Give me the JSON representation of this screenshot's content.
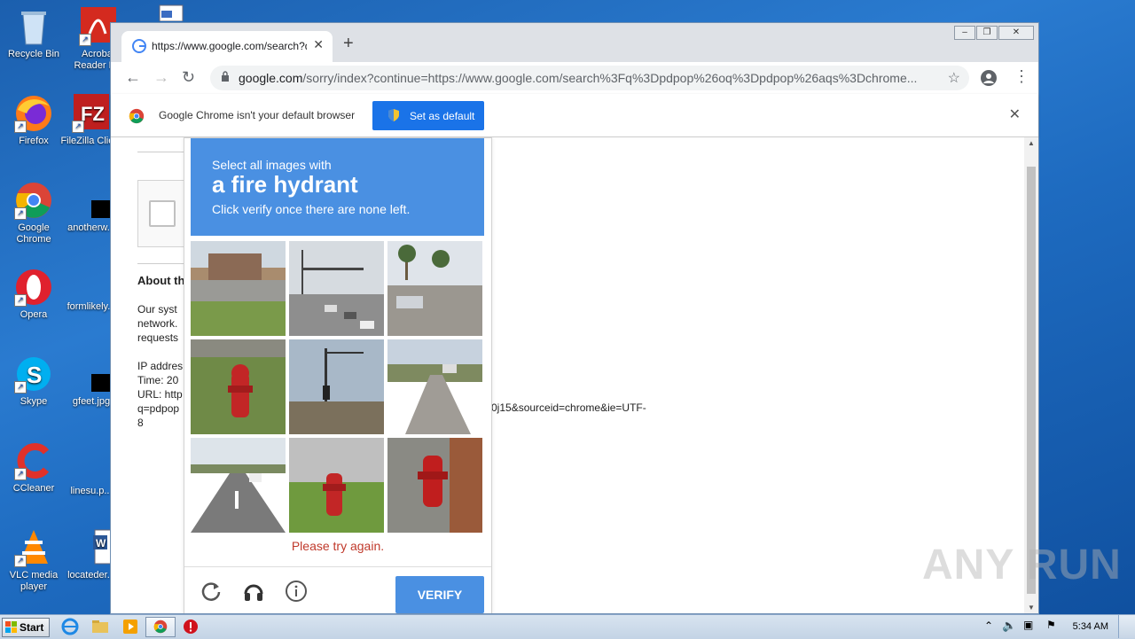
{
  "desktop": {
    "icons": [
      {
        "label": "Recycle Bin"
      },
      {
        "label": "Acrobat Reader DC"
      },
      {
        "label": "Firefox"
      },
      {
        "label": "FileZilla Client"
      },
      {
        "label": "Google Chrome"
      },
      {
        "label": "anotherw..."
      },
      {
        "label": "Opera"
      },
      {
        "label": "formlikely..."
      },
      {
        "label": "Skype"
      },
      {
        "label": "gfeet.jpg"
      },
      {
        "label": "CCleaner"
      },
      {
        "label": "linesu.p..."
      },
      {
        "label": "VLC media player"
      },
      {
        "label": "locateder..."
      }
    ]
  },
  "browser": {
    "tab_title": "https://www.google.com/search?q=",
    "url_host": "google.com",
    "url_rest": "/sorry/index?continue=https://www.google.com/search%3Fq%3Dpdpop%26oq%3Dpdpop%26aqs%3Dchrome...",
    "infobar": {
      "message": "Google Chrome isn't your default browser",
      "button": "Set as default"
    }
  },
  "page": {
    "heading": "About th",
    "para1": [
      "Our syst",
      "network.",
      "requests"
    ],
    "details": [
      "IP addres",
      "Time: 20",
      "URL: http",
      "q=pdpop"
    ],
    "url_tail": "0j15&sourceid=chrome&ie=UTF-",
    "url_tail2": "8"
  },
  "captcha": {
    "line1": "Select all images with",
    "line2": "a fire hydrant",
    "line3": "Click verify once there are none left.",
    "error": "Please try again.",
    "verify": "VERIFY",
    "tiles": [
      "building",
      "intersection",
      "street-palms",
      "hydrant",
      "traffic-light",
      "road",
      "highway",
      "hydrant",
      "hydrant"
    ]
  },
  "taskbar": {
    "start": "Start",
    "clock": "5:34 AM"
  },
  "watermark": "ANY RUN"
}
